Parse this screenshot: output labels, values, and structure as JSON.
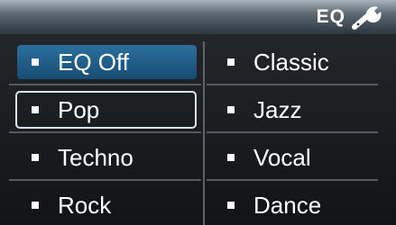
{
  "header": {
    "title": "EQ",
    "icon": "wrench-icon"
  },
  "menu": {
    "items": [
      {
        "label": "EQ Off",
        "selected": true,
        "focused": false
      },
      {
        "label": "Pop",
        "selected": false,
        "focused": true
      },
      {
        "label": "Techno",
        "selected": false,
        "focused": false
      },
      {
        "label": "Rock",
        "selected": false,
        "focused": false
      },
      {
        "label": "Classic",
        "selected": false,
        "focused": false
      },
      {
        "label": "Jazz",
        "selected": false,
        "focused": false
      },
      {
        "label": "Vocal",
        "selected": false,
        "focused": false
      },
      {
        "label": "Dance",
        "selected": false,
        "focused": false
      }
    ]
  },
  "colors": {
    "selected_background": "#1f5d8a",
    "focus_border": "#dce3ea",
    "text": "#ffffff"
  }
}
